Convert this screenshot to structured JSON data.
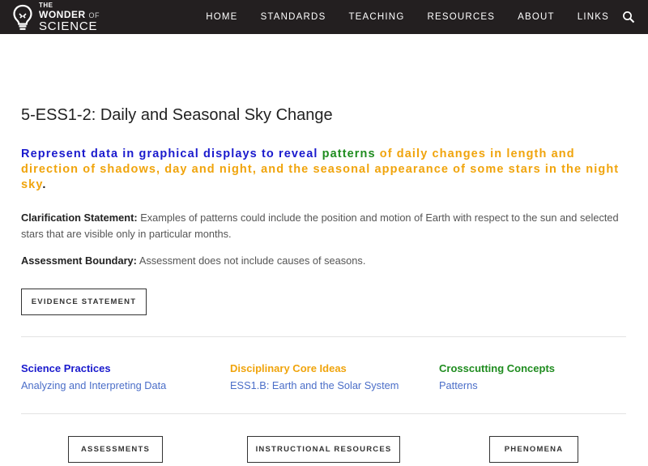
{
  "logo": {
    "line1": "THE",
    "line2_main": "WONDER",
    "line2_small": "OF",
    "line3": "SCIENCE"
  },
  "nav": {
    "items": [
      "HOME",
      "STANDARDS",
      "TEACHING",
      "RESOURCES",
      "ABOUT",
      "LINKS"
    ],
    "search_icon": "search-icon"
  },
  "page": {
    "title": "5-ESS1-2: Daily and Seasonal Sky Change",
    "pe": {
      "part1": "Represent data in graphical displays to reveal",
      "part2": "patterns",
      "part3": "of daily changes in length and direction of shadows, day and night, and the seasonal appearance of some stars in the night sky",
      "part4": "."
    },
    "clarification": {
      "label": "Clarification Statement:",
      "text": "Examples of patterns could include the position and motion of Earth with respect to the sun and selected stars that are visible only in particular months."
    },
    "boundary": {
      "label": "Assessment Boundary:",
      "text": "Assessment does not include causes of seasons."
    },
    "evidence_button": "EVIDENCE STATEMENT"
  },
  "dimensions": {
    "science_practices": {
      "heading": "Science Practices",
      "link": "Analyzing and Interpreting Data"
    },
    "core_ideas": {
      "heading": "Disciplinary Core Ideas",
      "link": "ESS1.B: Earth and the Solar System"
    },
    "crosscutting": {
      "heading": "Crosscutting Concepts",
      "link": "Patterns"
    }
  },
  "bottom_buttons": {
    "assessments": "ASSESSMENTS",
    "instructional": "INSTRUCTIONAL RESOURCES",
    "phenomena": "PHENOMENA"
  },
  "colors": {
    "nav_bg": "#231f20",
    "practices_blue": "#1a1acd",
    "crosscutting_green": "#1f8c1f",
    "core_ideas_orange": "#f0a40c",
    "link_blue": "#4b6ec8"
  }
}
